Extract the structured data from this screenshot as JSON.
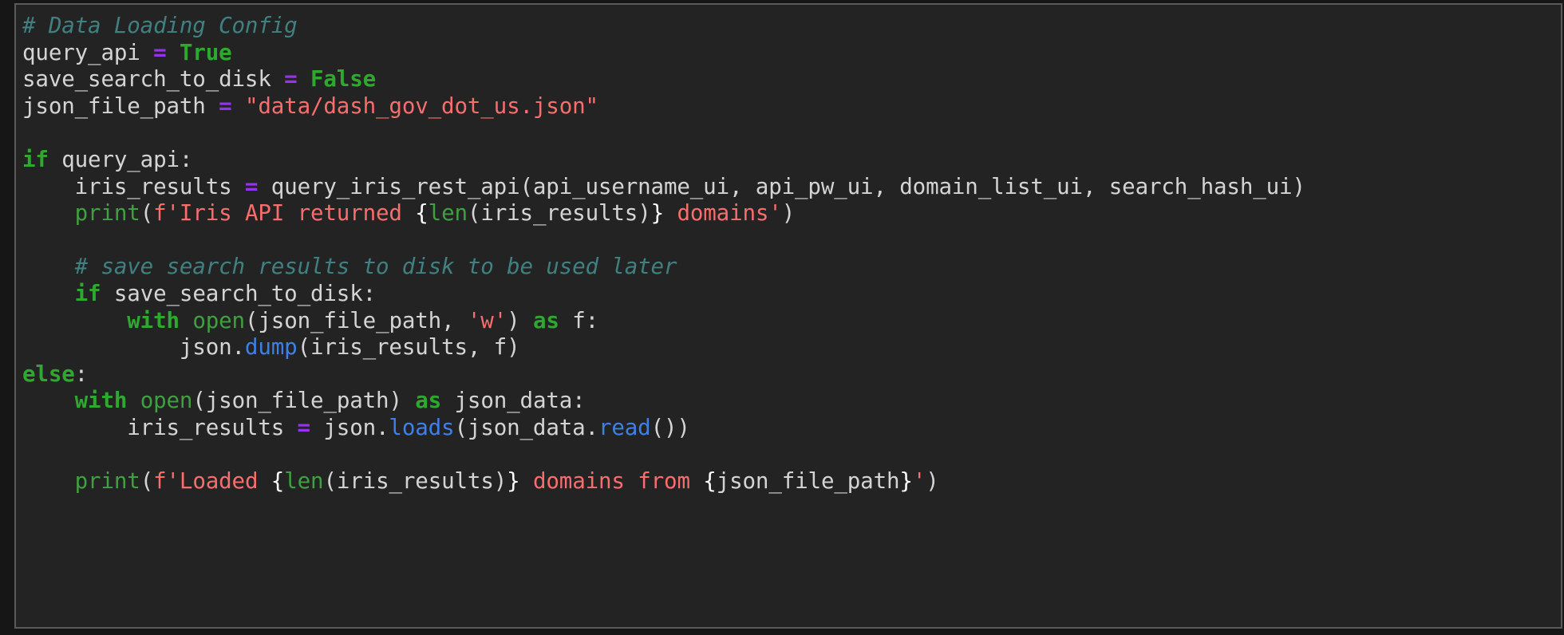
{
  "cell": {
    "language": "python",
    "background_color": "#232323",
    "border_color": "#5a5a5a",
    "outer_background_color": "#161616",
    "default_text_color": "#d4d4d4"
  },
  "palette": {
    "comment": "#408080",
    "keyword": "#2fa82f",
    "builtin": "#3fa03f",
    "constant": "#2fa82f",
    "operator": "#9733ee",
    "string": "#f86d6d",
    "function": "#3f7fe8",
    "plain": "#d4d4d4",
    "brace": "#ffffff"
  },
  "code": {
    "lines": [
      {
        "n": 1,
        "text": "# Data Loading Config"
      },
      {
        "n": 2,
        "text": "query_api = True"
      },
      {
        "n": 3,
        "text": "save_search_to_disk = False"
      },
      {
        "n": 4,
        "text": "json_file_path = \"data/dash_gov_dot_us.json\""
      },
      {
        "n": 5,
        "text": ""
      },
      {
        "n": 6,
        "text": "if query_api:"
      },
      {
        "n": 7,
        "text": "    iris_results = query_iris_rest_api(api_username_ui, api_pw_ui, domain_list_ui, search_hash_ui)"
      },
      {
        "n": 8,
        "text": "    print(f'Iris API returned {len(iris_results)} domains')"
      },
      {
        "n": 9,
        "text": ""
      },
      {
        "n": 10,
        "text": "    # save search results to disk to be used later"
      },
      {
        "n": 11,
        "text": "    if save_search_to_disk:"
      },
      {
        "n": 12,
        "text": "        with open(json_file_path, 'w') as f:"
      },
      {
        "n": 13,
        "text": "            json.dump(iris_results, f)"
      },
      {
        "n": 14,
        "text": "else:"
      },
      {
        "n": 15,
        "text": "    with open(json_file_path) as json_data:"
      },
      {
        "n": 16,
        "text": "        iris_results = json.loads(json_data.read())"
      },
      {
        "n": 17,
        "text": ""
      },
      {
        "n": 18,
        "text": "    print(f'Loaded {len(iris_results)} domains from {json_file_path}')"
      }
    ],
    "tokens": [
      [
        {
          "t": "# Data Loading Config",
          "c": "comment"
        }
      ],
      [
        {
          "t": "query_api ",
          "c": "plain"
        },
        {
          "t": "=",
          "c": "operator"
        },
        {
          "t": " ",
          "c": "plain"
        },
        {
          "t": "True",
          "c": "constant"
        }
      ],
      [
        {
          "t": "save_search_to_disk ",
          "c": "plain"
        },
        {
          "t": "=",
          "c": "operator"
        },
        {
          "t": " ",
          "c": "plain"
        },
        {
          "t": "False",
          "c": "constant"
        }
      ],
      [
        {
          "t": "json_file_path ",
          "c": "plain"
        },
        {
          "t": "=",
          "c": "operator"
        },
        {
          "t": " ",
          "c": "plain"
        },
        {
          "t": "\"data/dash_gov_dot_us.json\"",
          "c": "string"
        }
      ],
      [
        {
          "t": "",
          "c": "plain"
        }
      ],
      [
        {
          "t": "if",
          "c": "keyword"
        },
        {
          "t": " query_api:",
          "c": "plain"
        }
      ],
      [
        {
          "t": "    iris_results ",
          "c": "plain"
        },
        {
          "t": "=",
          "c": "operator"
        },
        {
          "t": " query_iris_rest_api(api_username_ui, api_pw_ui, domain_list_ui, search_hash_ui)",
          "c": "plain"
        }
      ],
      [
        {
          "t": "    ",
          "c": "plain"
        },
        {
          "t": "print",
          "c": "builtin"
        },
        {
          "t": "(",
          "c": "plain"
        },
        {
          "t": "f'Iris API returned ",
          "c": "string"
        },
        {
          "t": "{",
          "c": "brace"
        },
        {
          "t": "len",
          "c": "builtin"
        },
        {
          "t": "(iris_results)",
          "c": "plain"
        },
        {
          "t": "}",
          "c": "brace"
        },
        {
          "t": " domains'",
          "c": "string"
        },
        {
          "t": ")",
          "c": "plain"
        }
      ],
      [
        {
          "t": "",
          "c": "plain"
        }
      ],
      [
        {
          "t": "    ",
          "c": "plain"
        },
        {
          "t": "# save search results to disk to be used later",
          "c": "comment"
        }
      ],
      [
        {
          "t": "    ",
          "c": "plain"
        },
        {
          "t": "if",
          "c": "keyword"
        },
        {
          "t": " save_search_to_disk:",
          "c": "plain"
        }
      ],
      [
        {
          "t": "        ",
          "c": "plain"
        },
        {
          "t": "with",
          "c": "keyword"
        },
        {
          "t": " ",
          "c": "plain"
        },
        {
          "t": "open",
          "c": "builtin"
        },
        {
          "t": "(json_file_path, ",
          "c": "plain"
        },
        {
          "t": "'w'",
          "c": "string"
        },
        {
          "t": ") ",
          "c": "plain"
        },
        {
          "t": "as",
          "c": "keyword"
        },
        {
          "t": " f:",
          "c": "plain"
        }
      ],
      [
        {
          "t": "            json.",
          "c": "plain"
        },
        {
          "t": "dump",
          "c": "function"
        },
        {
          "t": "(iris_results, f)",
          "c": "plain"
        }
      ],
      [
        {
          "t": "else",
          "c": "keyword"
        },
        {
          "t": ":",
          "c": "plain"
        }
      ],
      [
        {
          "t": "    ",
          "c": "plain"
        },
        {
          "t": "with",
          "c": "keyword"
        },
        {
          "t": " ",
          "c": "plain"
        },
        {
          "t": "open",
          "c": "builtin"
        },
        {
          "t": "(json_file_path) ",
          "c": "plain"
        },
        {
          "t": "as",
          "c": "keyword"
        },
        {
          "t": " json_data:",
          "c": "plain"
        }
      ],
      [
        {
          "t": "        iris_results ",
          "c": "plain"
        },
        {
          "t": "=",
          "c": "operator"
        },
        {
          "t": " json.",
          "c": "plain"
        },
        {
          "t": "loads",
          "c": "function"
        },
        {
          "t": "(json_data.",
          "c": "plain"
        },
        {
          "t": "read",
          "c": "function"
        },
        {
          "t": "())",
          "c": "plain"
        }
      ],
      [
        {
          "t": "",
          "c": "plain"
        }
      ],
      [
        {
          "t": "    ",
          "c": "plain"
        },
        {
          "t": "print",
          "c": "builtin"
        },
        {
          "t": "(",
          "c": "plain"
        },
        {
          "t": "f'Loaded ",
          "c": "string"
        },
        {
          "t": "{",
          "c": "brace"
        },
        {
          "t": "len",
          "c": "builtin"
        },
        {
          "t": "(iris_results)",
          "c": "plain"
        },
        {
          "t": "}",
          "c": "brace"
        },
        {
          "t": " domains from ",
          "c": "string"
        },
        {
          "t": "{",
          "c": "brace"
        },
        {
          "t": "json_file_path",
          "c": "plain"
        },
        {
          "t": "}",
          "c": "brace"
        },
        {
          "t": "'",
          "c": "string"
        },
        {
          "t": ")",
          "c": "plain"
        }
      ]
    ]
  }
}
